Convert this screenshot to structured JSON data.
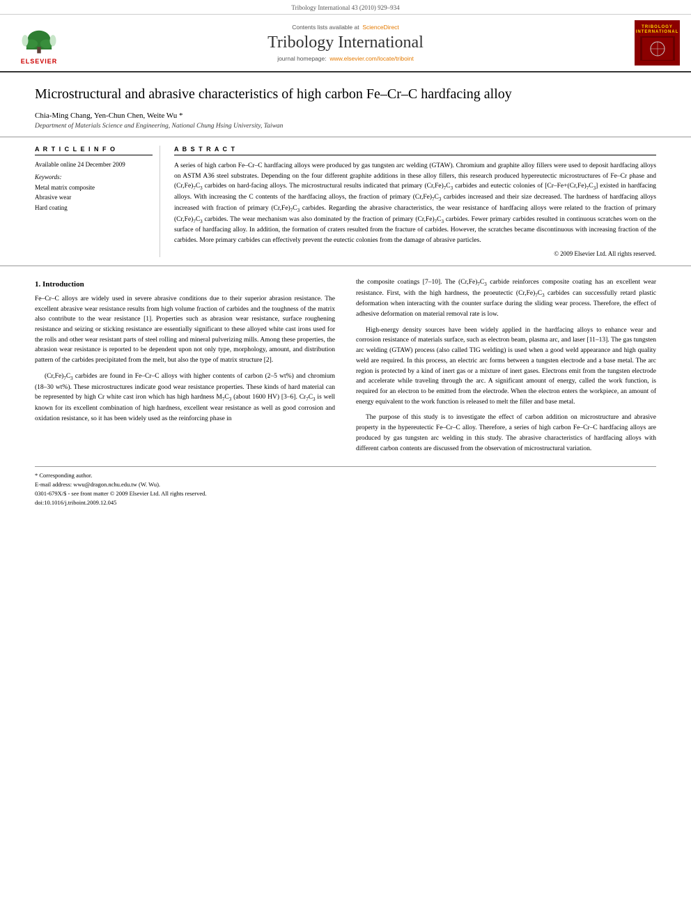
{
  "page": {
    "header_citation": "Tribology International 43 (2010) 929–934"
  },
  "banner": {
    "sciencedirect_prefix": "Contents lists available at",
    "sciencedirect_name": "ScienceDirect",
    "journal_title": "Tribology International",
    "homepage_prefix": "journal homepage:",
    "homepage_url": "www.elsevier.com/locate/triboint",
    "elsevier_label": "ELSEVIER",
    "tribology_label": "TRIBOLOGY INTERNATIONAL"
  },
  "article": {
    "title": "Microstructural and abrasive characteristics of high carbon Fe–Cr–C hardfacing alloy",
    "authors": "Chia-Ming Chang, Yen-Chun Chen, Weite Wu *",
    "affiliation": "Department of Materials Science and Engineering, National Chung Hsing University, Taiwan"
  },
  "article_info": {
    "section_label": "A R T I C L E   I N F O",
    "available_label": "Available online 24 December 2009",
    "keywords_label": "Keywords:",
    "keywords": [
      "Metal matrix composite",
      "Abrasive wear",
      "Hard coating"
    ]
  },
  "abstract": {
    "section_label": "A B S T R A C T",
    "text": "A series of high carbon Fe–Cr–C hardfacing alloys were produced by gas tungsten arc welding (GTAW). Chromium and graphite alloy fillers were used to deposit hardfacing alloys on ASTM A36 steel substrates. Depending on the four different graphite additions in these alloy fillers, this research produced hypereutectic microstructures of Fe–Cr phase and (Cr,Fe)7C3 carbides on hard-facing alloys. The microstructural results indicated that primary (Cr,Fe)7C3 carbides and eutectic colonies of [Cr–Fe+(Cr,Fe)7C3] existed in hardfacing alloys. With increasing the C contents of the hardfacing alloys, the fraction of primary (Cr,Fe)7C3 carbides increased and their size decreased. The hardness of hardfacing alloys increased with fraction of primary (Cr,Fe)7C3 carbides. Regarding the abrasive characteristics, the wear resistance of hardfacing alloys were related to the fraction of primary (Cr,Fe)7C3 carbides. The wear mechanism was also dominated by the fraction of primary (Cr,Fe)7C3 carbides. Fewer primary carbides resulted in continuous scratches worn on the surface of hardfacing alloy. In addition, the formation of craters resulted from the fracture of carbides. However, the scratches became discontinuous with increasing fraction of the carbides. More primary carbides can effectively prevent the eutectic colonies from the damage of abrasive particles.",
    "copyright": "© 2009 Elsevier Ltd. All rights reserved."
  },
  "introduction": {
    "heading": "1.  Introduction",
    "para1": "Fe–Cr–C alloys are widely used in severe abrasive conditions due to their superior abrasion resistance. The excellent abrasive wear resistance results from high volume fraction of carbides and the toughness of the matrix also contribute to the wear resistance [1]. Properties such as abrasion wear resistance, surface roughening resistance and seizing or sticking resistance are essentially significant to these alloyed white cast irons used for the rolls and other wear resistant parts of steel rolling and mineral pulverizing mills. Among these properties, the abrasion wear resistance is reported to be dependent upon not only type, morphology, amount, and distribution pattern of the carbides precipitated from the melt, but also the type of matrix structure [2].",
    "para2": "(Cr,Fe)7C3 carbides are found in Fe–Cr–C alloys with higher contents of carbon (2–5 wt%) and chromium (18–30 wt%). These microstructures indicate good wear resistance properties. These kinds of hard material can be represented by high Cr white cast iron which has high hardness M7C3 (about 1600 HV) [3–6]. Cr7C3 is well known for its excellent combination of high hardness, excellent wear resistance as well as good corrosion and oxidation resistance, so it has been widely used as the reinforcing phase in",
    "footnote_star": "* Corresponding author.",
    "footnote_email": "E-mail address: wwu@dragon.nchu.edu.tw (W. Wu).",
    "footnote_issn": "0301-679X/$ - see front matter © 2009 Elsevier Ltd. All rights reserved.",
    "footnote_doi": "doi:10.1016/j.triboint.2009.12.045"
  },
  "right_col": {
    "para1": "the composite coatings [7–10]. The (Cr,Fe)7C3 carbide reinforces composite coating has an excellent wear resistance. First, with the high hardness, the proeutectic (Cr,Fe)7C3 carbides can successfully retard plastic deformation when interacting with the counter surface during the sliding wear process. Therefore, the effect of adhesive deformation on material removal rate is low.",
    "para2": "High-energy density sources have been widely applied in the hardfacing alloys to enhance wear and corrosion resistance of materials surface, such as electron beam, plasma arc, and laser [11–13]. The gas tungsten arc welding (GTAW) process (also called TIG welding) is used when a good weld appearance and high quality weld are required. In this process, an electric arc forms between a tungsten electrode and a base metal. The arc region is protected by a kind of inert gas or a mixture of inert gases. Electrons emit from the tungsten electrode and accelerate while traveling through the arc. A significant amount of energy, called the work function, is required for an electron to be emitted from the electrode. When the electron enters the workpiece, an amount of energy equivalent to the work function is released to melt the filler and base metal.",
    "para3": "The purpose of this study is to investigate the effect of carbon addition on microstructure and abrasive property in the hypereutectic Fe–Cr–C alloy. Therefore, a series of high carbon Fe–Cr–C hardfacing alloys are produced by gas tungsten arc welding in this study. The abrasive characteristics of hardfacing alloys with different carbon contents are discussed from the observation of microstructural variation."
  }
}
